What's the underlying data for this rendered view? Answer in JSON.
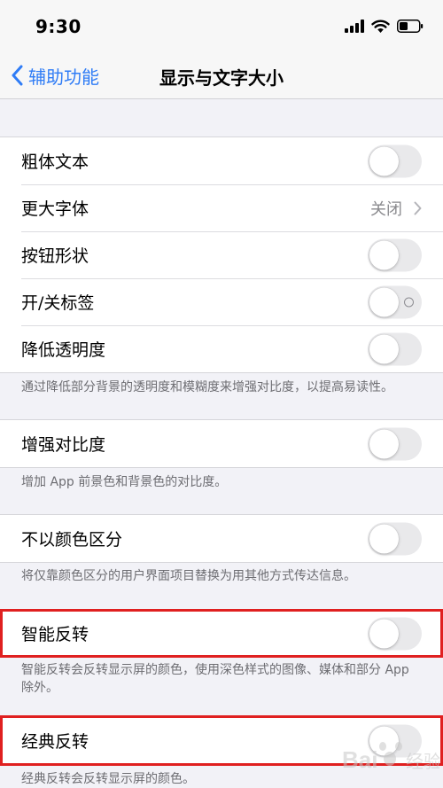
{
  "status_bar": {
    "time": "9:30"
  },
  "nav": {
    "back_label": "辅助功能",
    "title": "显示与文字大小"
  },
  "groups": [
    {
      "rows": [
        {
          "label": "粗体文本",
          "control": "toggle",
          "on": false
        },
        {
          "label": "更大字体",
          "control": "disclosure",
          "value": "关闭"
        },
        {
          "label": "按钮形状",
          "control": "toggle",
          "on": false
        },
        {
          "label": "开/关标签",
          "control": "toggle",
          "on": false
        },
        {
          "label": "降低透明度",
          "control": "toggle",
          "on": false
        }
      ],
      "footer": "通过降低部分背景的透明度和模糊度来增强对比度，以提高易读性。"
    },
    {
      "rows": [
        {
          "label": "增强对比度",
          "control": "toggle",
          "on": false
        }
      ],
      "footer": "增加 App 前景色和背景色的对比度。"
    },
    {
      "rows": [
        {
          "label": "不以颜色区分",
          "control": "toggle",
          "on": false
        }
      ],
      "footer": "将仅靠颜色区分的用户界面项目替换为用其他方式传达信息。"
    },
    {
      "rows": [
        {
          "label": "智能反转",
          "control": "toggle",
          "on": false
        }
      ],
      "footer": "智能反转会反转显示屏的颜色，使用深色样式的图像、媒体和部分 App 除外。"
    },
    {
      "rows": [
        {
          "label": "经典反转",
          "control": "toggle",
          "on": false
        }
      ],
      "footer": "经典反转会反转显示屏的颜色。"
    }
  ],
  "colors": {
    "accent": "#2f7cf6",
    "highlight": "#e02020",
    "toggle_off": "#e9e9eb",
    "background": "#f2f2f7"
  },
  "watermark": {
    "text": "Bai 经验"
  }
}
